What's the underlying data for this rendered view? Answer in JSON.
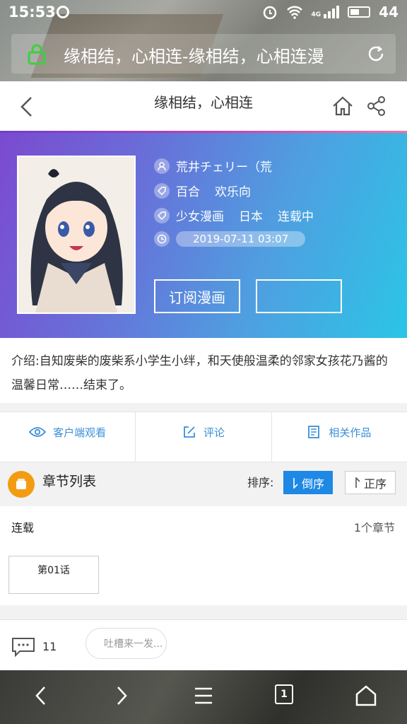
{
  "status_bar": {
    "time": "15:53",
    "network": "4G",
    "battery": "44"
  },
  "url_bar": {
    "text": "缘相结，心相连-缘相结，心相连漫"
  },
  "nav": {
    "title": "缘相结，心相连"
  },
  "comic": {
    "author": "荒井チェリー（荒",
    "tags": [
      "百合",
      "欢乐向"
    ],
    "meta": [
      "少女漫画",
      "日本",
      "连载中"
    ],
    "updated": "2019-07-11 03:07",
    "subscribe_label": "订阅漫画",
    "secondary_button_label": ""
  },
  "intro": {
    "text": "介绍:自知废柴的废柴系小学生小绊，和天使般温柔的邻家女孩花乃酱的温馨日常……结束了。"
  },
  "actions": [
    {
      "label": "客户端观看",
      "icon": "eye-icon"
    },
    {
      "label": "评论",
      "icon": "edit-icon"
    },
    {
      "label": "相关作品",
      "icon": "book-icon"
    }
  ],
  "chapters_header": {
    "title": "章节列表",
    "sort_label": "排序:",
    "sort_desc": "倒序",
    "sort_asc": "正序"
  },
  "chapter_section": {
    "label": "连载",
    "count": "1个章节",
    "chapters": [
      "第01话"
    ]
  },
  "comment_bar": {
    "count": "11",
    "placeholder": "吐槽来一发..."
  },
  "colors": {
    "accent_blue": "#1e88e5",
    "link_blue": "#3b8fd9",
    "orange": "#f39c12",
    "banner_start": "#7b4ad0",
    "banner_end": "#2bc5e6"
  }
}
